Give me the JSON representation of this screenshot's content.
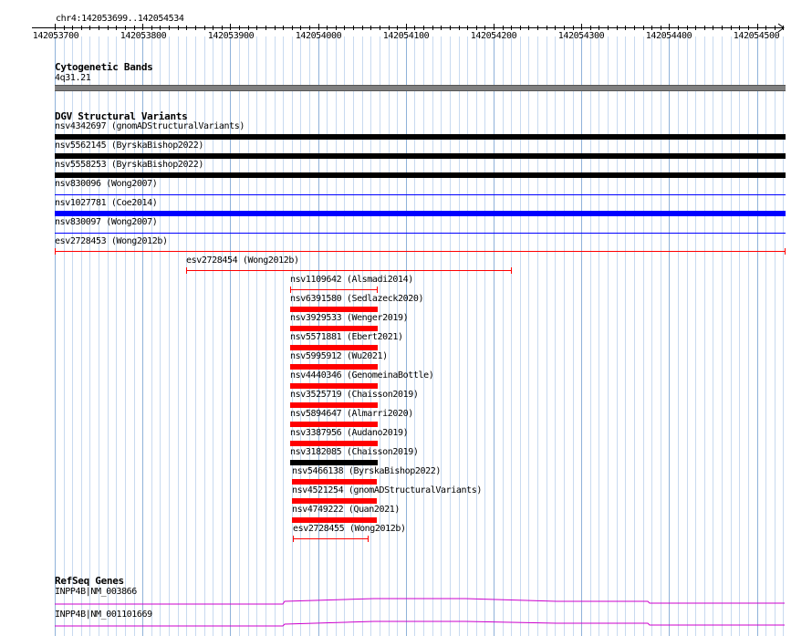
{
  "ruler": {
    "location": "chr4:142053699..142054534",
    "ticks": [
      "142053700",
      "142053800",
      "142053900",
      "142054000",
      "142054100",
      "142054200",
      "142054300",
      "142054400",
      "142054500"
    ]
  },
  "cytoband": {
    "title": "Cytogenetic Bands",
    "band": "4q31.21"
  },
  "dgv": {
    "title": "DGV Structural Variants",
    "colors": {
      "black": "#000000",
      "blue": "#0000ff",
      "red": "#ff0000"
    },
    "features": [
      {
        "label": "nsv4342697 (gnomADStructuralVariants)",
        "style": "thick",
        "color": "black"
      },
      {
        "label": "nsv5562145 (ByrskaBishop2022)",
        "style": "thick",
        "color": "black"
      },
      {
        "label": "nsv5558253 (ByrskaBishop2022)",
        "style": "thick",
        "color": "black"
      },
      {
        "label": "nsv830096 (Wong2007)",
        "style": "thin",
        "color": "blue"
      },
      {
        "label": "nsv1027781 (Coe2014)",
        "style": "thick",
        "color": "blue"
      },
      {
        "label": "nsv830097 (Wong2007)",
        "style": "thin",
        "color": "blue"
      },
      {
        "label": "esv2728453 (Wong2012b)",
        "style": "capped",
        "color": "red"
      },
      {
        "label": "esv2728454 (Wong2012b)",
        "style": "capped",
        "color": "red"
      },
      {
        "label": "nsv1109642 (Alsmadi2014)",
        "style": "capped",
        "color": "red"
      },
      {
        "label": "nsv6391580 (Sedlazeck2020)",
        "style": "thick",
        "color": "red"
      },
      {
        "label": "nsv3929533 (Wenger2019)",
        "style": "thick",
        "color": "red"
      },
      {
        "label": "nsv5571881 (Ebert2021)",
        "style": "thick",
        "color": "red"
      },
      {
        "label": "nsv5995912 (Wu2021)",
        "style": "thick",
        "color": "red"
      },
      {
        "label": "nsv4440346 (GenomeinaBottle)",
        "style": "thick",
        "color": "red"
      },
      {
        "label": "nsv3525719 (Chaisson2019)",
        "style": "thick",
        "color": "red"
      },
      {
        "label": "nsv5894647 (Almarri2020)",
        "style": "thick",
        "color": "red"
      },
      {
        "label": "nsv3387956 (Audano2019)",
        "style": "thick",
        "color": "red"
      },
      {
        "label": "nsv3182085 (Chaisson2019)",
        "style": "thick",
        "color": "black"
      },
      {
        "label": "nsv5466138 (ByrskaBishop2022)",
        "style": "thick",
        "color": "red"
      },
      {
        "label": "nsv4521254 (gnomADStructuralVariants)",
        "style": "thick",
        "color": "red"
      },
      {
        "label": "nsv4749222 (Quan2021)",
        "style": "thick",
        "color": "red"
      },
      {
        "label": "esv2728455 (Wong2012b)",
        "style": "capped",
        "color": "red"
      }
    ]
  },
  "refseq": {
    "title": "RefSeq Genes",
    "color": "#cc00cc",
    "genes": [
      {
        "label": "INPP4B|NM_003866"
      },
      {
        "label": "INPP4B|NM_001101669"
      }
    ]
  }
}
